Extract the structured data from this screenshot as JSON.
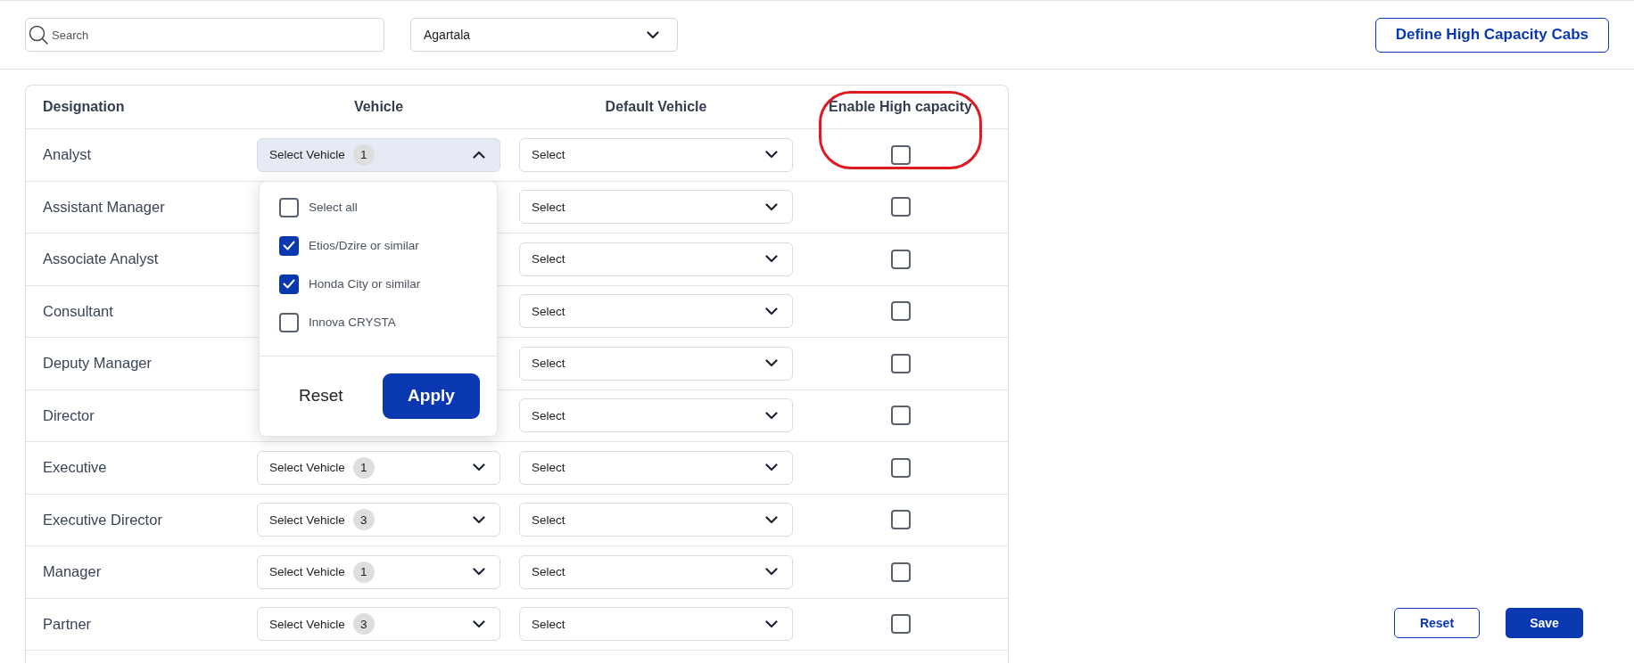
{
  "toolbar": {
    "search": {
      "placeholder": "Search"
    },
    "city": {
      "value": "Agartala"
    },
    "define_button": "Define High Capacity Cabs"
  },
  "table": {
    "columns": [
      {
        "label": "Designation",
        "marked": false
      },
      {
        "label": "Vehicle",
        "marked": false
      },
      {
        "label": "Default Vehicle",
        "marked": false
      },
      {
        "label": "Enable High capacity",
        "marked": true
      }
    ],
    "rows": [
      {
        "designation": "Analyst",
        "vehicle": {
          "label": "Select Vehicle",
          "count": "1",
          "expanded": true
        },
        "default_vehicle": "Select",
        "high_capacity": false
      },
      {
        "designation": "Assistant Manager",
        "vehicle": null,
        "default_vehicle": "Select",
        "high_capacity": false
      },
      {
        "designation": "Associate Analyst",
        "vehicle": null,
        "default_vehicle": "Select",
        "high_capacity": false
      },
      {
        "designation": "Consultant",
        "vehicle": null,
        "default_vehicle": "Select",
        "high_capacity": false
      },
      {
        "designation": "Deputy Manager",
        "vehicle": null,
        "default_vehicle": "Select",
        "high_capacity": false
      },
      {
        "designation": "Director",
        "vehicle": null,
        "default_vehicle": "Select",
        "high_capacity": false
      },
      {
        "designation": "Executive",
        "vehicle": {
          "label": "Select Vehicle",
          "count": "1",
          "expanded": false
        },
        "default_vehicle": "Select",
        "high_capacity": false
      },
      {
        "designation": "Executive Director",
        "vehicle": {
          "label": "Select Vehicle",
          "count": "3",
          "expanded": false
        },
        "default_vehicle": "Select",
        "high_capacity": false
      },
      {
        "designation": "Manager",
        "vehicle": {
          "label": "Select Vehicle",
          "count": "1",
          "expanded": false
        },
        "default_vehicle": "Select",
        "high_capacity": false
      },
      {
        "designation": "Partner",
        "vehicle": {
          "label": "Select Vehicle",
          "count": "3",
          "expanded": false
        },
        "default_vehicle": "Select",
        "high_capacity": false
      }
    ]
  },
  "vehicle_menu": {
    "options": [
      {
        "label": "Select all",
        "checked": false
      },
      {
        "label": "Etios/Dzire or similar",
        "checked": true
      },
      {
        "label": "Honda City or similar",
        "checked": true
      },
      {
        "label": "Innova CRYSTA",
        "checked": false
      }
    ],
    "reset": "Reset",
    "apply": "Apply"
  },
  "footer": {
    "reset": "Reset",
    "save": "Save"
  }
}
